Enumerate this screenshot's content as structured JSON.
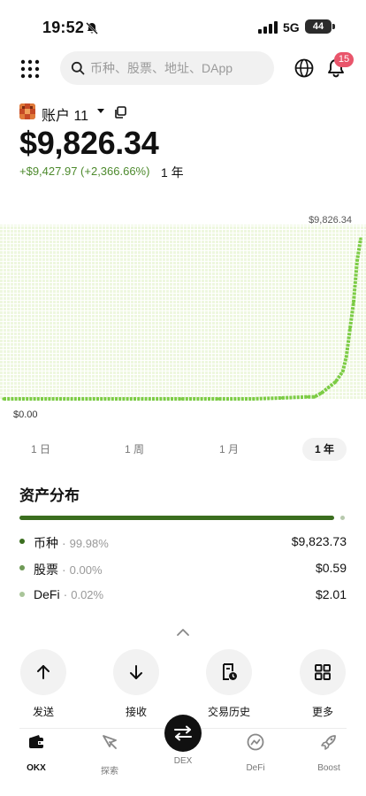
{
  "status_bar": {
    "time": "19:52",
    "network": "5G",
    "battery": "44"
  },
  "header": {
    "search_placeholder": "币种、股票、地址、DApp",
    "notification_count": "15"
  },
  "account": {
    "name": "账户 11",
    "balance": "$9,826.34",
    "pnl": "+$9,427.97 (+2,366.66%)",
    "period": "1 年"
  },
  "chart_data": {
    "type": "area",
    "max_label": "$9,826.34",
    "min_label": "$0.00",
    "ylim": [
      0,
      9826.34
    ],
    "x": [
      0,
      0.5,
      0.6,
      0.7,
      0.78,
      0.85,
      0.87,
      0.89,
      0.91,
      0.93,
      0.95,
      0.96,
      0.97,
      0.98,
      0.99,
      1.0
    ],
    "values": [
      0,
      0,
      0,
      0,
      60,
      120,
      120,
      360,
      700,
      1050,
      1700,
      2600,
      4300,
      5900,
      8500,
      9826.34
    ],
    "accent_color": "#7ccc45"
  },
  "period_tabs": [
    {
      "label": "1 日",
      "active": false
    },
    {
      "label": "1 周",
      "active": false
    },
    {
      "label": "1 月",
      "active": false
    },
    {
      "label": "1 年",
      "active": true
    }
  ],
  "distribution": {
    "title": "资产分布",
    "items": [
      {
        "name": "币种",
        "pct": "99.98%",
        "value": "$9,823.73",
        "color": "#3b6e1f"
      },
      {
        "name": "股票",
        "pct": "0.00%",
        "value": "$0.59",
        "color": "#6f9a56"
      },
      {
        "name": "DeFi",
        "pct": "0.02%",
        "value": "$2.01",
        "color": "#a9c599"
      }
    ]
  },
  "actions": [
    {
      "label": "发送",
      "icon": "arrow-up-icon"
    },
    {
      "label": "接收",
      "icon": "arrow-down-icon"
    },
    {
      "label": "交易历史",
      "icon": "history-icon"
    },
    {
      "label": "更多",
      "icon": "grid-icon"
    }
  ],
  "bottom_nav": [
    {
      "label": "OKX",
      "icon": "wallet-icon",
      "active": true
    },
    {
      "label": "探索",
      "icon": "compass-icon",
      "active": false
    },
    {
      "label": "DEX",
      "icon": "swap-icon",
      "active": false
    },
    {
      "label": "DeFi",
      "icon": "defi-icon",
      "active": false
    },
    {
      "label": "Boost",
      "icon": "rocket-icon",
      "active": false
    }
  ]
}
